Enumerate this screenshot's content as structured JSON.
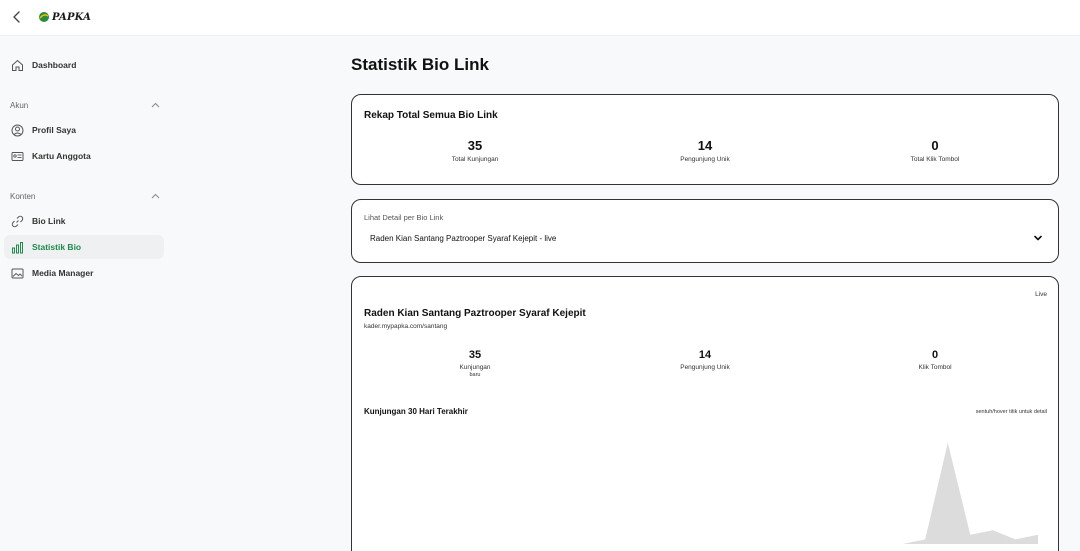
{
  "header": {
    "logo_text": "PAPKA"
  },
  "sidebar": {
    "dashboard": "Dashboard",
    "section_akun": "Akun",
    "profil": "Profil Saya",
    "kartu": "Kartu Anggota",
    "section_konten": "Konten",
    "biolink": "Bio Link",
    "statistik": "Statistik Bio",
    "media": "Media Manager"
  },
  "main": {
    "title": "Statistik Bio Link",
    "summary": {
      "title": "Rekap Total Semua Bio Link",
      "stats": [
        {
          "value": "35",
          "label": "Total Kunjungan"
        },
        {
          "value": "14",
          "label": "Pengunjung Unik"
        },
        {
          "value": "0",
          "label": "Total Klik Tombol"
        }
      ]
    },
    "detail_select": {
      "label": "Lihat Detail per Bio Link",
      "selected": "Raden Kian Santang Paztrooper Syaraf Kejepit - live"
    },
    "detail": {
      "status": "Live",
      "name": "Raden Kian Santang Paztrooper Syaraf Kejepit",
      "url": "kader.mypapka.com/santang",
      "stats": [
        {
          "value": "35",
          "label": "Kunjungan",
          "sub": "baru"
        },
        {
          "value": "14",
          "label": "Pengunjung Unik",
          "sub": ""
        },
        {
          "value": "0",
          "label": "Klik Tombol",
          "sub": ""
        }
      ],
      "chart_title": "Kunjungan 30 Hari Terakhir",
      "chart_hint": "sentuh/hover titik untuk detail"
    }
  },
  "chart_data": {
    "type": "area",
    "title": "Kunjungan 30 Hari Terakhir",
    "xlabel": "",
    "ylabel": "",
    "series": [
      {
        "values": [
          0,
          0,
          0,
          0,
          0,
          0,
          0,
          0,
          0,
          0,
          0,
          0,
          0,
          0,
          0,
          0,
          0,
          0,
          0,
          0,
          0,
          0,
          0,
          0,
          1,
          22,
          2,
          3,
          1,
          2
        ]
      }
    ],
    "ylim": [
      0,
      25
    ],
    "grid": false,
    "color": "#dcdcdc"
  },
  "colors": {
    "accent": "#1f8a4c",
    "border": "#333333",
    "area": "#dcdcdc"
  }
}
